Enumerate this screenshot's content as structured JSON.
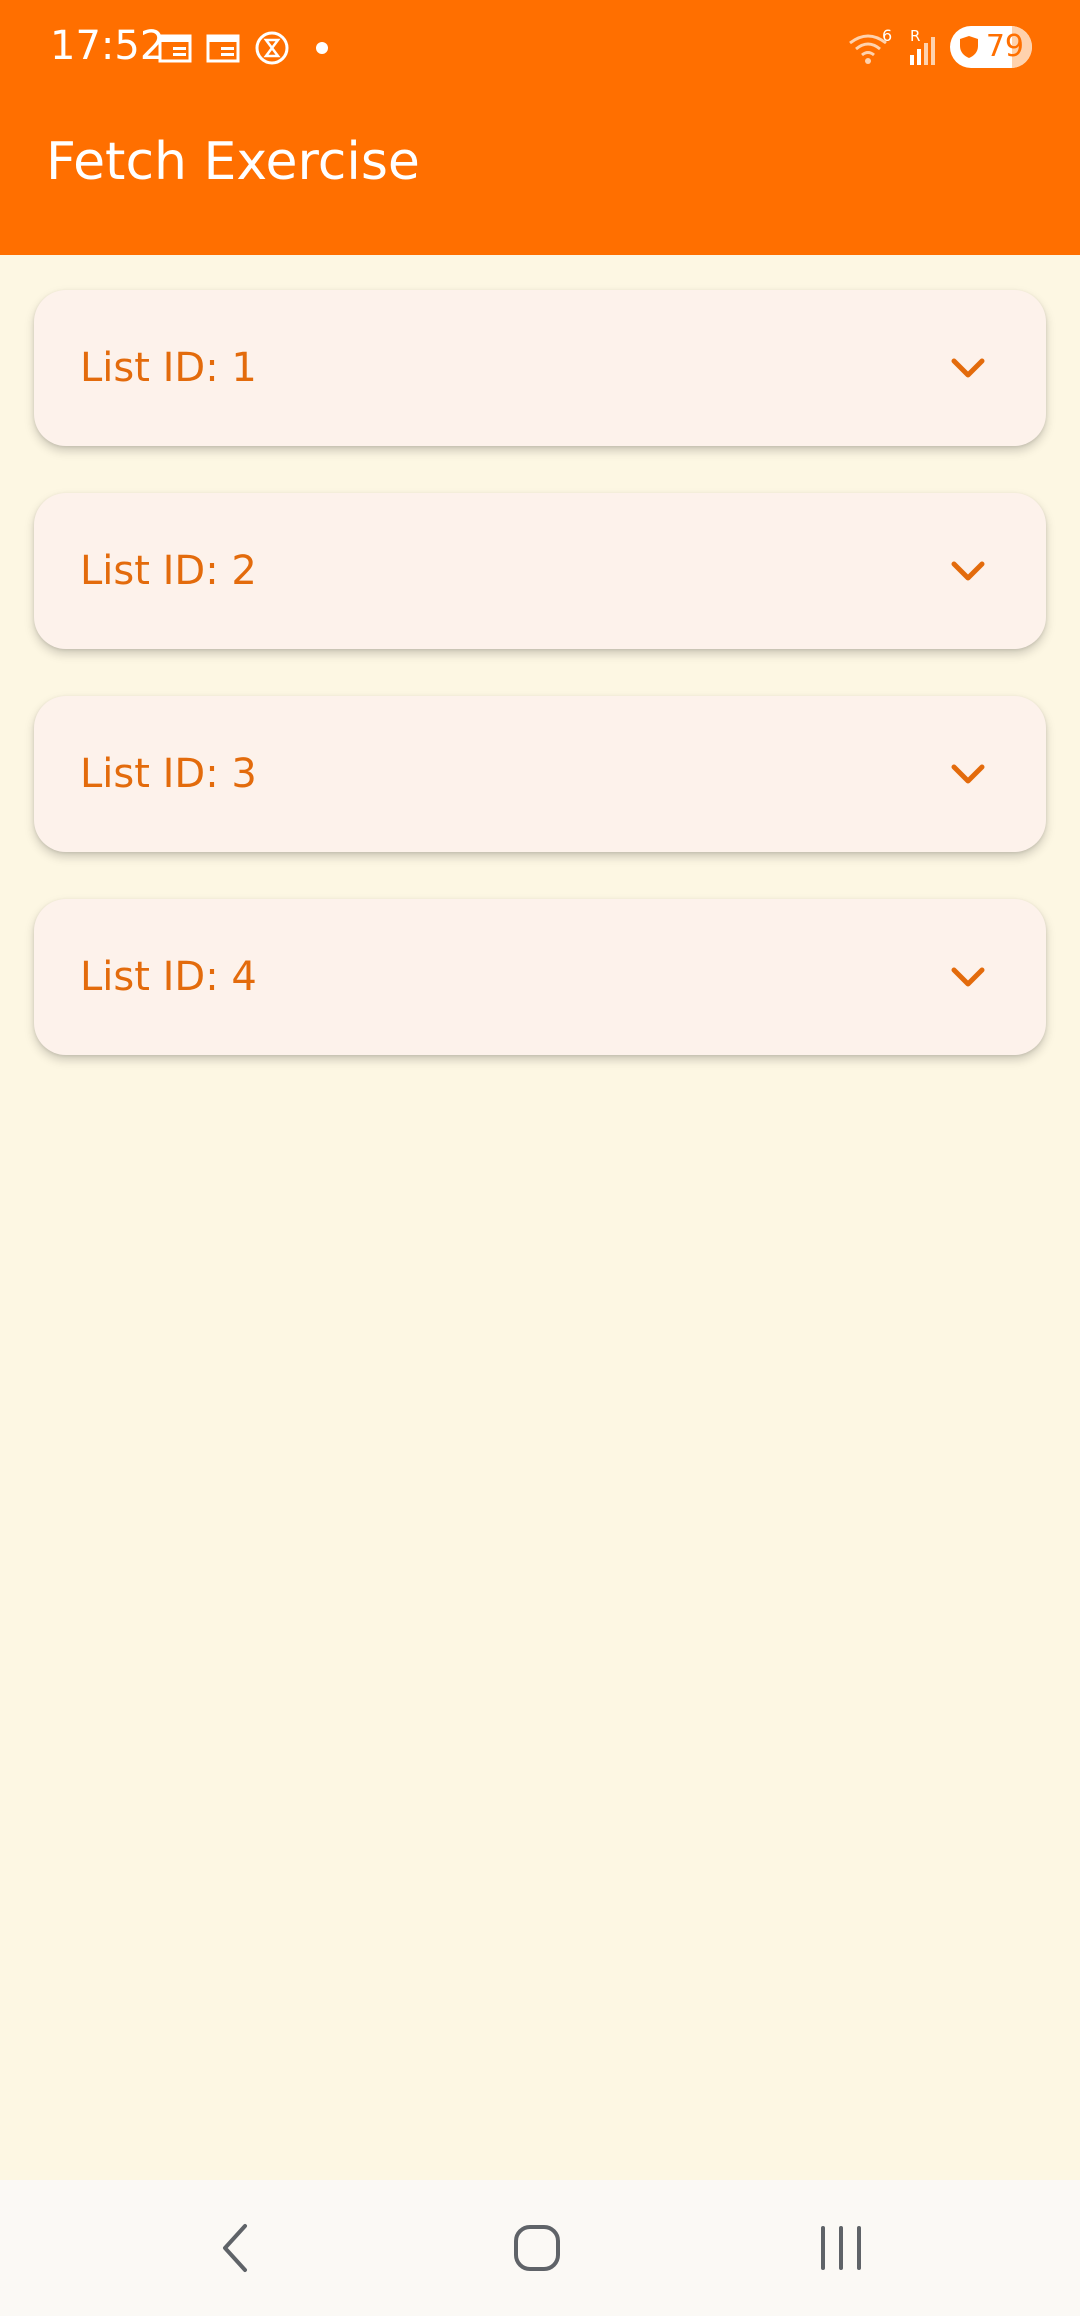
{
  "status_bar": {
    "time": "17:52",
    "left_icons": [
      "calendar-icon",
      "calendar-icon",
      "hourglass-icon",
      "notification-dot-icon"
    ],
    "right_icons": [
      "wifi-icon",
      "signal-icon",
      "battery-icon"
    ],
    "network_badge": "6",
    "roaming_badge": "R",
    "battery_level": "79"
  },
  "app_bar": {
    "title": "Fetch Exercise",
    "color": "#ff6f00"
  },
  "list": {
    "items": [
      {
        "label": "List ID: 1",
        "icon": "chevron-down-icon"
      },
      {
        "label": "List ID: 2",
        "icon": "chevron-down-icon"
      },
      {
        "label": "List ID: 3",
        "icon": "chevron-down-icon"
      },
      {
        "label": "List ID: 4",
        "icon": "chevron-down-icon"
      }
    ],
    "card_color": "#fdf2eb",
    "text_color": "#e36b0c"
  },
  "nav_bar": {
    "buttons": [
      "back-icon",
      "home-icon",
      "recent-apps-icon"
    ]
  },
  "colors": {
    "background": "#fdf7e3",
    "accent": "#ff6f00"
  }
}
